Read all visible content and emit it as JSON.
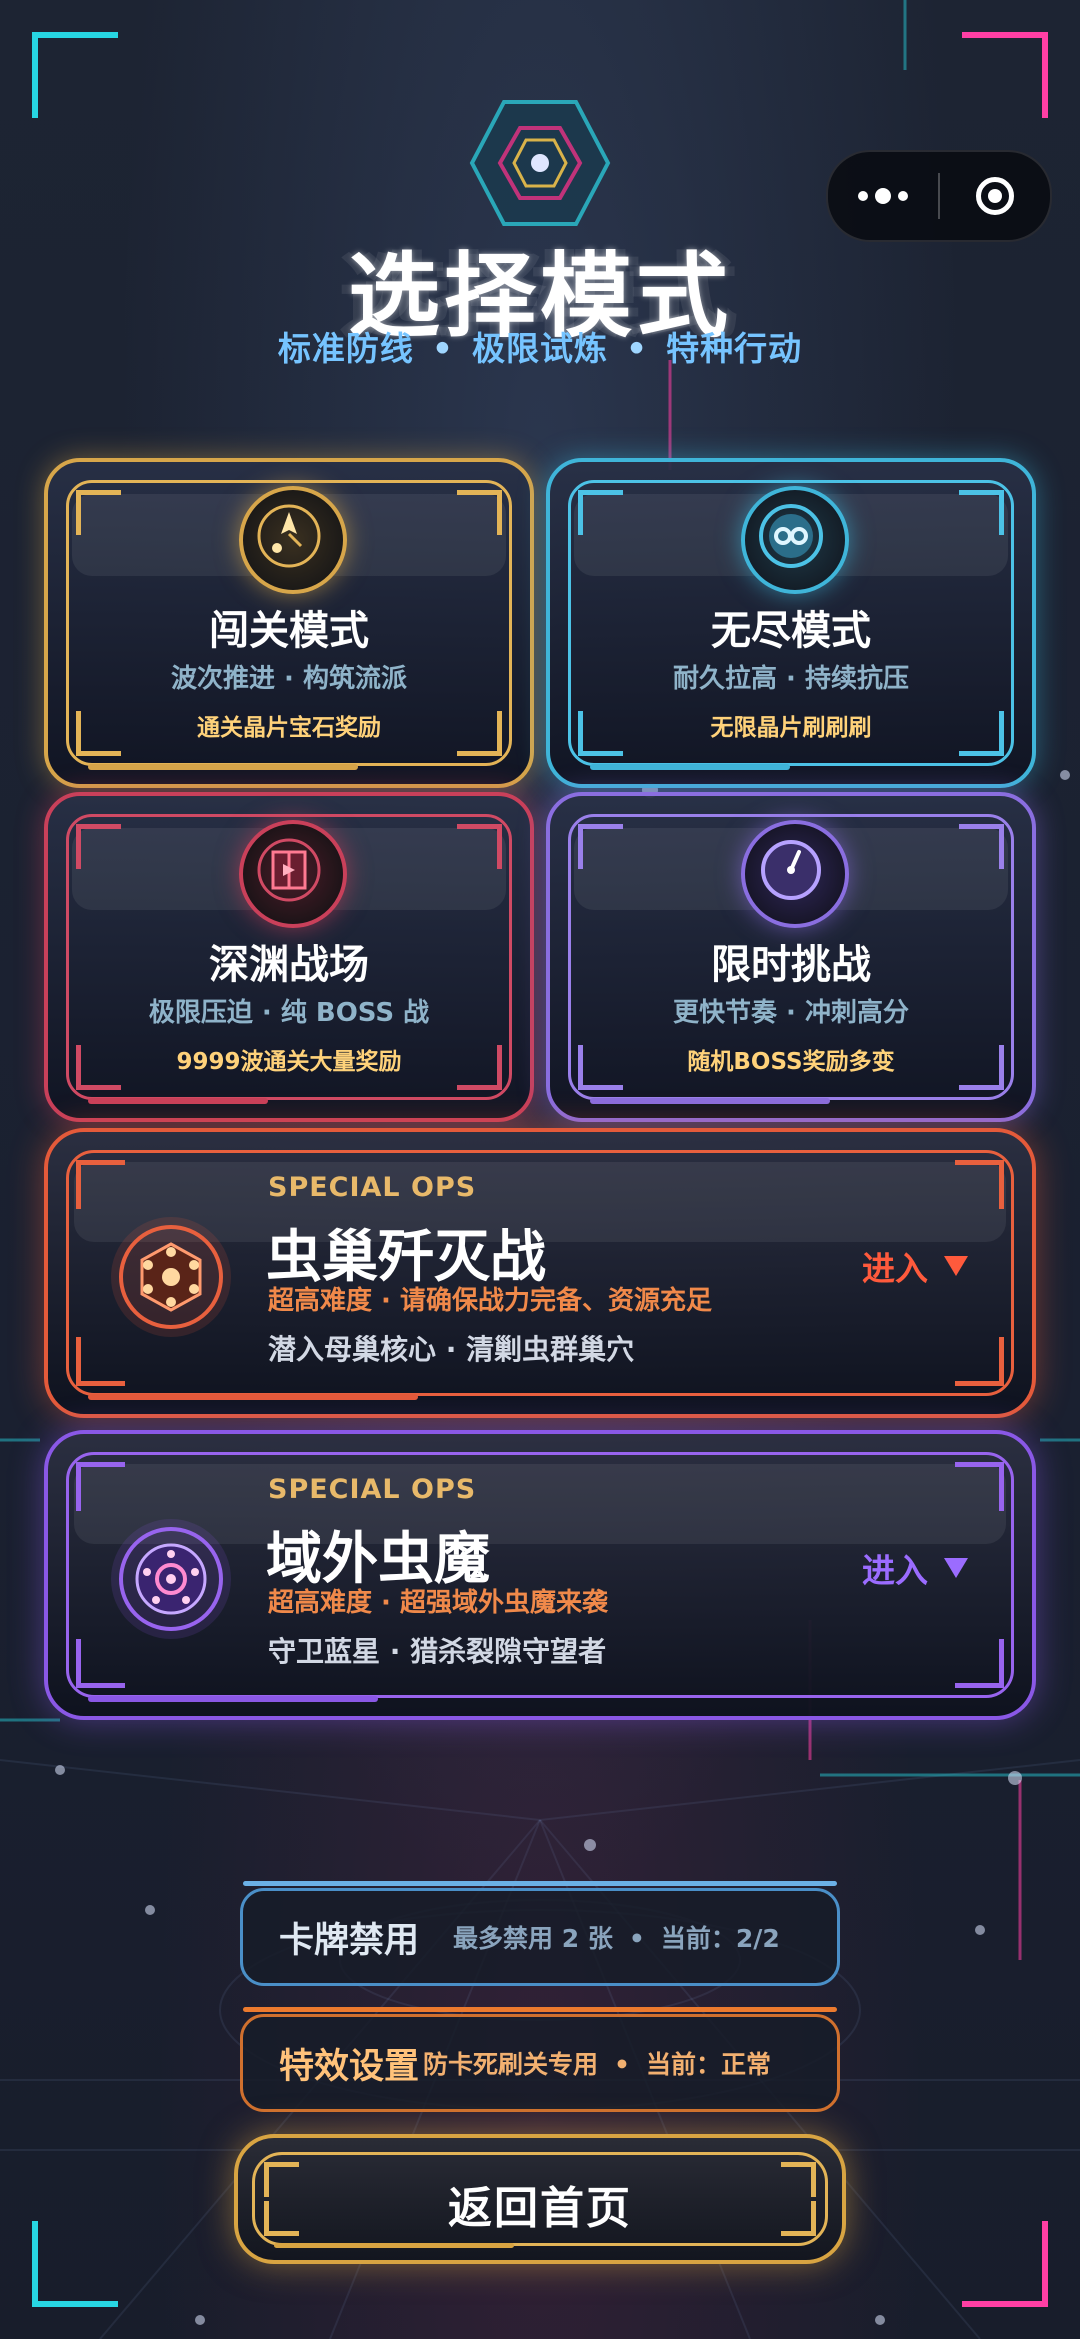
{
  "header": {
    "title": "选择模式",
    "subtitle_items": [
      "标准防线",
      "极限试炼",
      "特种行动"
    ],
    "subtitle_separator": "•"
  },
  "modes": [
    {
      "name": "闯关模式",
      "desc": "波次推进 · 构筑流派",
      "reward": "通关晶片宝石奖励",
      "color": "#d7a64a",
      "icon": "compass-icon"
    },
    {
      "name": "无尽模式",
      "desc": "耐久拉高 · 持续抗压",
      "reward": "无限晶片刷刷刷",
      "color": "#3fb5d9",
      "icon": "infinity-icon"
    },
    {
      "name": "深渊战场",
      "desc": "极限压迫 · 纯 BOSS 战",
      "reward": "9999波通关大量奖励",
      "color": "#c9405a",
      "icon": "abyss-gate-icon"
    },
    {
      "name": "限时挑战",
      "desc": "更快节奏 · 冲刺高分",
      "reward": "随机BOSS奖励多变",
      "color": "#8a6ee0",
      "icon": "stopwatch-icon"
    }
  ],
  "special_ops": [
    {
      "tag": "SPECIAL OPS",
      "title": "虫巢歼灭战",
      "warning": "超高难度 · 请确保战力完备、资源充足",
      "subtitle": "潜入母巢核心 · 清剿虫群巢穴",
      "enter_label": "进入",
      "color": "#e45a3a",
      "icon": "hive-emblem-icon"
    },
    {
      "tag": "SPECIAL OPS",
      "title": "域外虫魔",
      "warning": "超高难度 · 超强域外虫魔来袭",
      "subtitle": "守卫蓝星 · 猎杀裂隙守望者",
      "enter_label": "进入",
      "color": "#8a58e6",
      "icon": "rift-emblem-icon"
    }
  ],
  "settings": {
    "card_ban": {
      "label": "卡牌禁用",
      "info": "最多禁用 2 张",
      "current": "当前：2/2",
      "color": "#4a8fc8"
    },
    "effects": {
      "label": "特效设置",
      "info": "防卡死刷关专用",
      "current": "当前：正常",
      "color": "#d0702e"
    }
  },
  "back_button": {
    "label": "返回首页"
  },
  "capsule": {
    "more_icon": "more-dots-icon",
    "close_icon": "target-close-icon"
  },
  "accents": {
    "cyan": "#27d6e2",
    "pink": "#ff3fa4",
    "gold": "#d8a442"
  }
}
